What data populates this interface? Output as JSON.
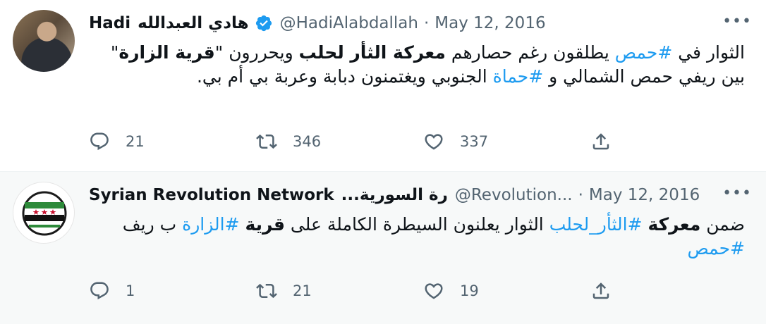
{
  "tweets": [
    {
      "name": "Hadi",
      "name_ar": "هادي العبدالله",
      "handle": "@HadiAlabdallah",
      "separator": "·",
      "date": "May 12, 2016",
      "more": "•••",
      "body_segments": [
        {
          "text": "الثوار في ",
          "type": "text"
        },
        {
          "text": "#حمص",
          "type": "hashtag"
        },
        {
          "text": " يطلقون رغم حصارهم ",
          "type": "text"
        },
        {
          "text": "معركة الثأر لحلب",
          "type": "bold"
        },
        {
          "text": " ويحررون \"",
          "type": "text"
        },
        {
          "text": "قرية الزارة",
          "type": "bold"
        },
        {
          "text": "\" بين ريفي حمص الشمالي و ",
          "type": "text"
        },
        {
          "text": "#حماة",
          "type": "hashtag"
        },
        {
          "text": " الجنوبي ويغتمنون دبابة وعربة بي أم بي.",
          "type": "text"
        }
      ],
      "replies": "21",
      "retweets": "346",
      "likes": "337",
      "icons": {
        "reply": "reply-icon",
        "retweet": "retweet-icon",
        "like": "heart-icon",
        "share": "share-icon"
      }
    },
    {
      "name": "Syrian Revolution Network",
      "name_ar": "...رة السورية",
      "handle": "@Revolution...",
      "separator": "·",
      "date": "May 12, 2016",
      "more": "•••",
      "body_segments": [
        {
          "text": "ضمن ",
          "type": "text"
        },
        {
          "text": "معركة",
          "type": "bold"
        },
        {
          "text": " ",
          "type": "text"
        },
        {
          "text": "#الثأر_لحلب",
          "type": "hashtag"
        },
        {
          "text": " الثوار يعلنون السيطرة الكاملة على ",
          "type": "text"
        },
        {
          "text": "قرية",
          "type": "bold"
        },
        {
          "text": " ",
          "type": "text"
        },
        {
          "text": "#الزارة",
          "type": "hashtag"
        },
        {
          "text": " ب ريف ",
          "type": "text"
        },
        {
          "text": "#حمص",
          "type": "hashtag"
        }
      ],
      "replies": "1",
      "retweets": "21",
      "likes": "19",
      "icons": {
        "reply": "reply-icon",
        "retweet": "retweet-icon",
        "like": "heart-icon",
        "share": "share-icon"
      }
    }
  ],
  "colors": {
    "text": "#0f1419",
    "secondary": "#536471",
    "link": "#1d9bf0",
    "verified": "#1d9bf0",
    "row_alt_bg": "#f7f9f9"
  }
}
